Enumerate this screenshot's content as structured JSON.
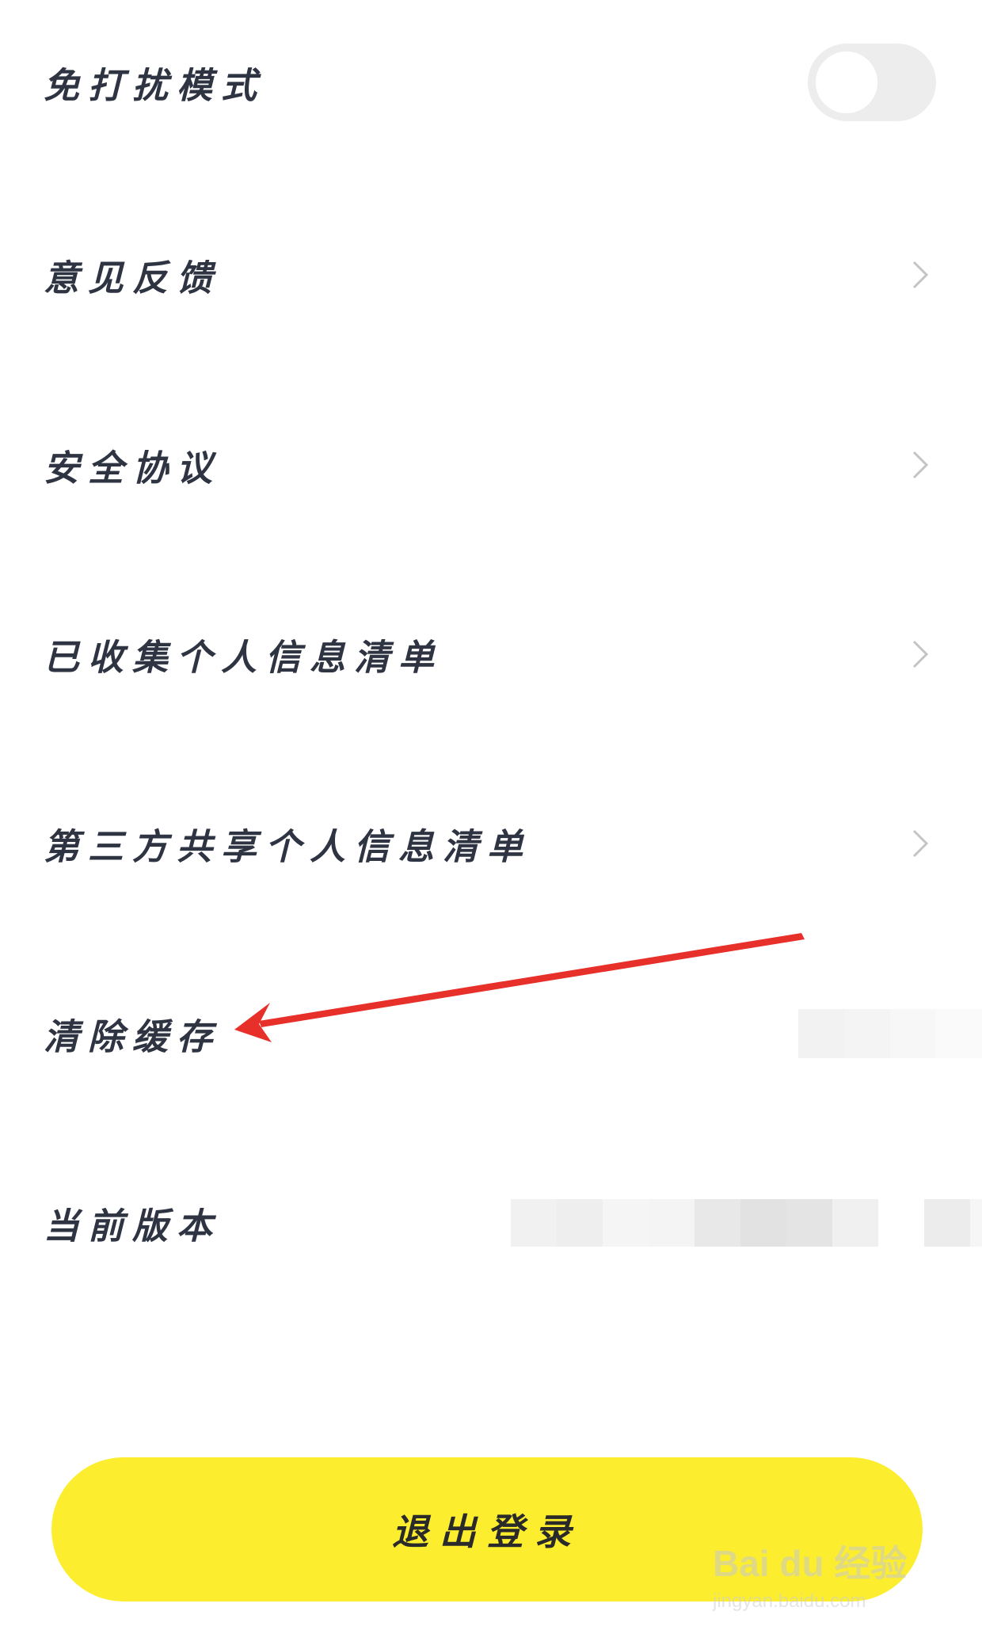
{
  "settings": {
    "items": [
      {
        "label": "免打扰模式",
        "control": "toggle",
        "toggle_on": false
      },
      {
        "label": "意见反馈",
        "control": "chevron-right-icon"
      },
      {
        "label": "安全协议",
        "control": "chevron-right-icon"
      },
      {
        "label": "已收集个人信息清单",
        "control": "chevron-right-icon"
      },
      {
        "label": "第三方共享个人信息清单",
        "control": "chevron-right-icon"
      },
      {
        "label": "清除缓存",
        "control": "blurred-value"
      },
      {
        "label": "当前版本",
        "control": "blurred-value"
      }
    ]
  },
  "logout": {
    "label": "退出登录"
  },
  "annotation": {
    "type": "red-arrow",
    "target": "清除缓存",
    "color": "#e8302a"
  },
  "watermark": {
    "text": "Bai du 经验",
    "sub": "jingyan.baidu.com"
  },
  "colors": {
    "accent_yellow": "#fcee2e",
    "label_text": "#2e3442",
    "chevron": "#c4c4c4",
    "toggle_track": "#ededed"
  }
}
